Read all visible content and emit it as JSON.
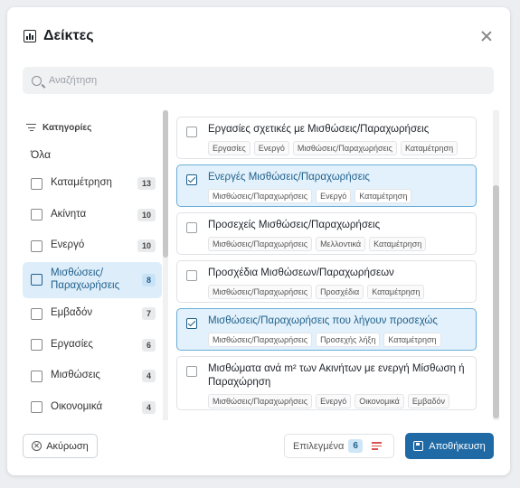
{
  "dialog": {
    "title": "Δείκτες"
  },
  "search": {
    "placeholder": "Αναζήτηση"
  },
  "sidebar": {
    "header": "Κατηγορίες",
    "all_label": "Όλα",
    "items": [
      {
        "label": "Καταμέτρηση",
        "count": "13",
        "icon": "list-icon"
      },
      {
        "label": "Ακίνητα",
        "count": "10",
        "icon": "building-icon"
      },
      {
        "label": "Ενεργό",
        "count": "10",
        "icon": "play-icon"
      },
      {
        "label": "Μισθώσεις/ Παραχωρήσεις",
        "count": "8",
        "icon": "key-icon",
        "active": true
      },
      {
        "label": "Εμβαδόν",
        "count": "7",
        "icon": "area-icon"
      },
      {
        "label": "Εργασίες",
        "count": "6",
        "icon": "checklist-icon"
      },
      {
        "label": "Μισθώσεις",
        "count": "4",
        "icon": "key-icon"
      },
      {
        "label": "Οικονομικά",
        "count": "4",
        "icon": "euro-icon"
      }
    ]
  },
  "list": {
    "items": [
      {
        "name": "Εργασίες σχετικές με Μισθώσεις/Παραχωρήσεις",
        "selected": false,
        "tags": [
          "Εργασίες",
          "Ενεργό",
          "Μισθώσεις/Παραχωρήσεις",
          "Καταμέτρηση"
        ]
      },
      {
        "name": "Ενεργές Μισθώσεις/Παραχωρήσεις",
        "selected": true,
        "tags": [
          "Μισθώσεις/Παραχωρήσεις",
          "Ενεργό",
          "Καταμέτρηση"
        ]
      },
      {
        "name": "Προσεχείς Μισθώσεις/Παραχωρήσεις",
        "selected": false,
        "tags": [
          "Μισθώσεις/Παραχωρήσεις",
          "Μελλοντικά",
          "Καταμέτρηση"
        ]
      },
      {
        "name": "Προσχέδια Μισθώσεων/Παραχωρήσεων",
        "selected": false,
        "tags": [
          "Μισθώσεις/Παραχωρήσεις",
          "Προσχέδια",
          "Καταμέτρηση"
        ]
      },
      {
        "name": "Μισθώσεις/Παραχωρήσεις που λήγουν προσεχώς",
        "selected": true,
        "tags": [
          "Μισθώσεις/Παραχωρήσεις",
          "Προσεχής λήξη",
          "Καταμέτρηση"
        ]
      },
      {
        "name": "Μισθώματα ανά m² των Ακινήτων με ενεργή Μίσθωση ή Παραχώρηση",
        "selected": false,
        "tags": [
          "Μισθώσεις/Παραχωρήσεις",
          "Ενεργό",
          "Οικονομικά",
          "Εμβαδόν"
        ]
      }
    ]
  },
  "footer": {
    "cancel_label": "Ακύρωση",
    "selected_label": "Επιλεγμένα",
    "selected_count": "6",
    "save_label": "Αποθήκευση"
  },
  "colors": {
    "accent": "#1f6aa5",
    "selected_bg": "#e2f1fb",
    "clear_icon": "#d9534f"
  }
}
